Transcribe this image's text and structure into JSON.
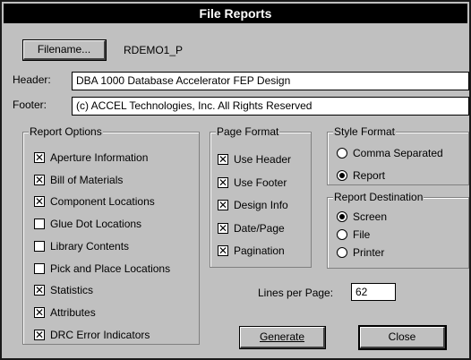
{
  "window": {
    "title": "File Reports"
  },
  "filename": {
    "button_label": "Filename...",
    "value": "RDEMO1_P"
  },
  "header": {
    "label": "Header:",
    "value": "DBA 1000 Database Accelerator FEP Design"
  },
  "footer": {
    "label": "Footer:",
    "value": "(c) ACCEL Technologies, Inc.  All Rights Reserved"
  },
  "report_options": {
    "title": "Report Options",
    "items": [
      {
        "label": "Aperture Information",
        "checked": true
      },
      {
        "label": "Bill of Materials",
        "checked": true
      },
      {
        "label": "Component Locations",
        "checked": true
      },
      {
        "label": "Glue Dot Locations",
        "checked": false
      },
      {
        "label": "Library Contents",
        "checked": false
      },
      {
        "label": "Pick and Place Locations",
        "checked": false
      },
      {
        "label": "Statistics",
        "checked": true
      },
      {
        "label": "Attributes",
        "checked": true
      },
      {
        "label": "DRC Error Indicators",
        "checked": true
      }
    ]
  },
  "page_format": {
    "title": "Page Format",
    "items": [
      {
        "label": "Use Header",
        "checked": true
      },
      {
        "label": "Use Footer",
        "checked": true
      },
      {
        "label": "Design Info",
        "checked": true
      },
      {
        "label": "Date/Page",
        "checked": true
      },
      {
        "label": "Pagination",
        "checked": true
      }
    ]
  },
  "style_format": {
    "title": "Style Format",
    "options": [
      {
        "label": "Comma Separated",
        "selected": false
      },
      {
        "label": "Report",
        "selected": true
      }
    ]
  },
  "report_destination": {
    "title": "Report Destination",
    "options": [
      {
        "label": "Screen",
        "selected": true
      },
      {
        "label": "File",
        "selected": false
      },
      {
        "label": "Printer",
        "selected": false
      }
    ]
  },
  "lines_per_page": {
    "label": "Lines per Page:",
    "value": "62"
  },
  "buttons": {
    "generate": "Generate",
    "close": "Close"
  }
}
